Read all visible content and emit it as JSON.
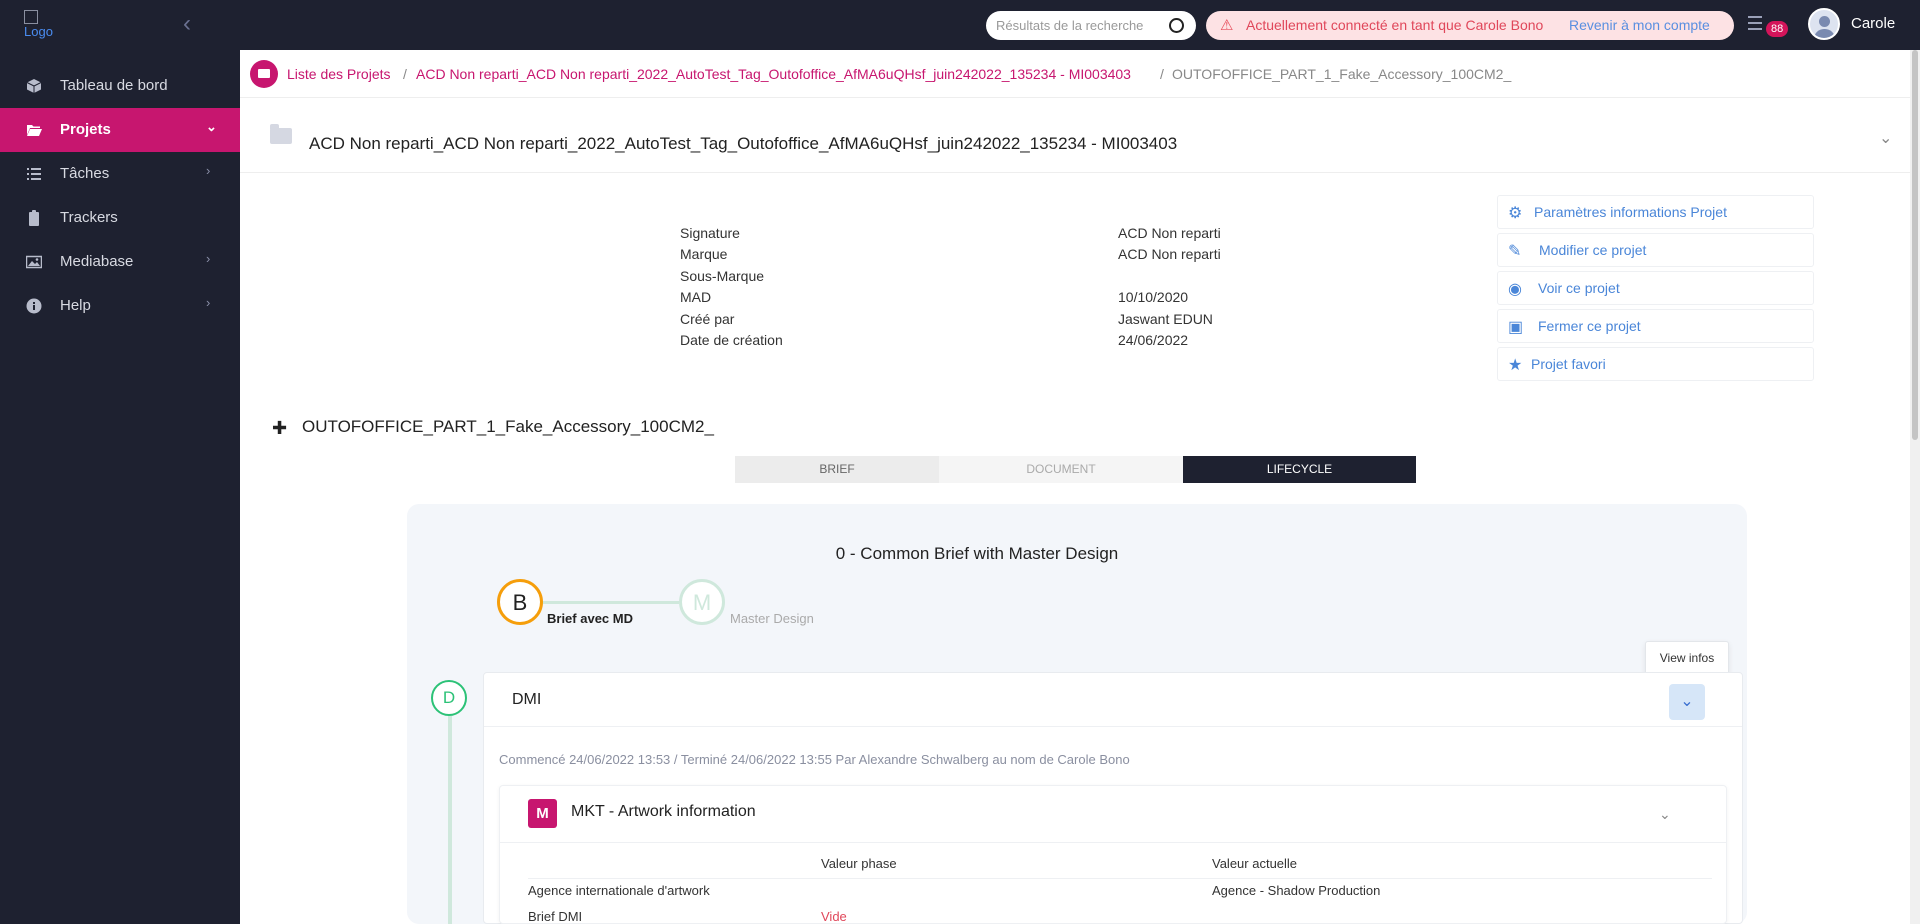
{
  "topbar": {
    "logo_alt": "Logo",
    "search_placeholder": "Résultats de la recherche",
    "impersonation_message": "Actuellement connecté en tant que Carole Bono",
    "back_link": "Revenir à mon compte",
    "notification_count": "88",
    "user_name": "Carole",
    "colors": {
      "background": "#1e2130",
      "accent": "#c7166f"
    }
  },
  "sidebar": {
    "items": [
      {
        "label": "Tableau de bord",
        "icon": "cube-icon",
        "has_children": false,
        "active": false
      },
      {
        "label": "Projets",
        "icon": "folder-open-icon",
        "has_children": true,
        "active": true
      },
      {
        "label": "Tâches",
        "icon": "list-icon",
        "has_children": true,
        "active": false
      },
      {
        "label": "Trackers",
        "icon": "clipboard-icon",
        "has_children": false,
        "active": false
      },
      {
        "label": "Mediabase",
        "icon": "image-icon",
        "has_children": true,
        "active": false
      },
      {
        "label": "Help",
        "icon": "info-icon",
        "has_children": true,
        "active": false
      }
    ]
  },
  "breadcrumb": {
    "items": [
      "Liste des Projets",
      "ACD Non reparti_ACD Non reparti_2022_AutoTest_Tag_Outofoffice_AfMA6uQHsf_juin242022_135234 - MI003403",
      "OUTOFOFFICE_PART_1_Fake_Accessory_100CM2_"
    ]
  },
  "project": {
    "title": "ACD Non reparti_ACD Non reparti_2022_AutoTest_Tag_Outofoffice_AfMA6uQHsf_juin242022_135234 - MI003403",
    "info": [
      {
        "label": "Signature",
        "value": "ACD Non reparti"
      },
      {
        "label": "Marque",
        "value": "ACD Non reparti"
      },
      {
        "label": "Sous-Marque",
        "value": ""
      },
      {
        "label": "MAD",
        "value": "10/10/2020"
      },
      {
        "label": "Créé par",
        "value": "Jaswant EDUN"
      },
      {
        "label": "Date de création",
        "value": "24/06/2022"
      }
    ],
    "actions": [
      {
        "label": "Paramètres informations Projet",
        "icon": "gear-icon"
      },
      {
        "label": "Modifier ce projet",
        "icon": "edit-icon"
      },
      {
        "label": "Voir ce projet",
        "icon": "eye-icon"
      },
      {
        "label": "Fermer ce projet",
        "icon": "box-icon"
      },
      {
        "label": "Projet favori",
        "icon": "star-icon"
      }
    ]
  },
  "part": {
    "title": "OUTOFOFFICE_PART_1_Fake_Accessory_100CM2_",
    "tabs": [
      {
        "label": "BRIEF",
        "active": false
      },
      {
        "label": "DOCUMENT",
        "active": false
      },
      {
        "label": "LIFECYCLE",
        "active": true
      }
    ]
  },
  "lifecycle": {
    "phase_title": "0 - Common Brief with Master Design",
    "steps": [
      {
        "letter": "B",
        "label": "Brief avec MD",
        "current": true
      },
      {
        "letter": "M",
        "label": "Master Design",
        "current": false
      }
    ],
    "tooltip": "View infos",
    "stage": {
      "letter": "D",
      "title": "DMI",
      "meta": "Commencé 24/06/2022 13:53 / Terminé 24/06/2022 13:55 Par Alexandre Schwalberg au nom de Carole Bono",
      "section": {
        "badge": "M",
        "title": "MKT - Artwork information",
        "columns": [
          "",
          "Valeur phase",
          "Valeur actuelle"
        ],
        "rows": [
          {
            "label": "Agence internationale d'artwork",
            "phase": "",
            "current": "Agence - Shadow Production"
          },
          {
            "label": "Brief DMI",
            "phase": "Vide",
            "current": ""
          }
        ]
      }
    }
  }
}
